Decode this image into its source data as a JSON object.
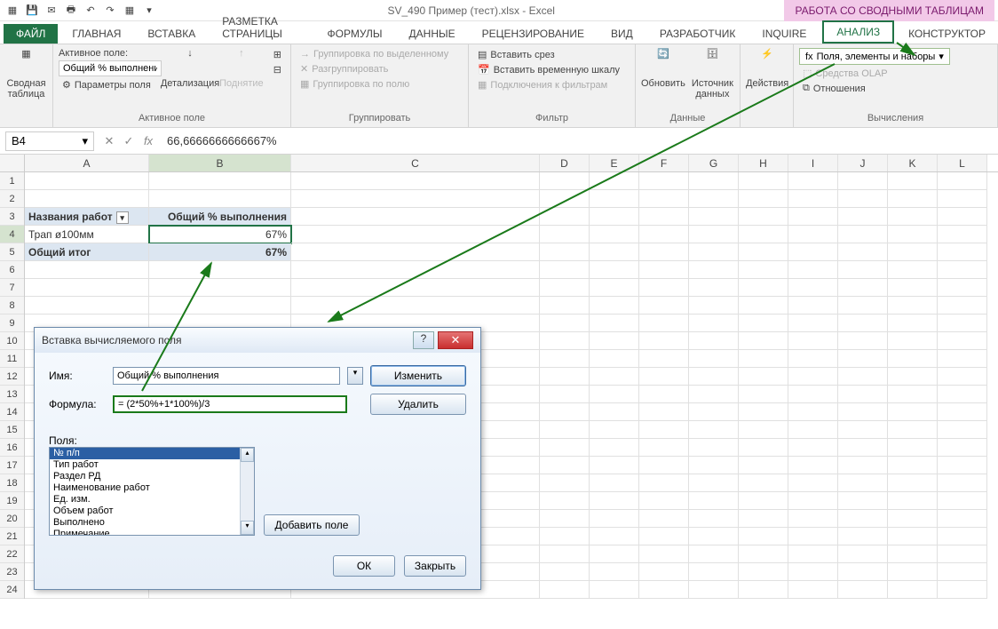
{
  "title": "SV_490 Пример (тест).xlsx - Excel",
  "context_title": "РАБОТА СО СВОДНЫМИ ТАБЛИЦАМ",
  "tabs": {
    "file": "ФАЙЛ",
    "home": "ГЛАВНАЯ",
    "insert": "ВСТАВКА",
    "layout": "РАЗМЕТКА СТРАНИЦЫ",
    "formulas": "ФОРМУЛЫ",
    "data": "ДАННЫЕ",
    "review": "РЕЦЕНЗИРОВАНИЕ",
    "view": "ВИД",
    "developer": "РАЗРАБОТЧИК",
    "inquire": "INQUIRE",
    "analyze": "АНАЛИЗ",
    "design": "КОНСТРУКТОР"
  },
  "ribbon": {
    "pivot": "Сводная\nтаблица",
    "active_field_label": "Активное поле:",
    "active_field_value": "Общий % выполнени",
    "field_settings": "Параметры поля",
    "active_field_group": "Активное поле",
    "detail": "Детализация",
    "collapse": "Поднятие",
    "group_sel": "Группировка по выделенному",
    "ungroup": "Разгруппировать",
    "group_field": "Группировка по полю",
    "group_group": "Группировать",
    "slicer": "Вставить срез",
    "timeline": "Вставить временную шкалу",
    "filter_conn": "Подключения к фильтрам",
    "filter_group": "Фильтр",
    "refresh": "Обновить",
    "datasource": "Источник\nданных",
    "data_group": "Данные",
    "actions": "Действия",
    "fields_calc": "Поля, элементы и наборы",
    "olap": "Средства OLAP",
    "relations": "Отношения",
    "calc_group": "Вычисления"
  },
  "namebox": "B4",
  "formula": "66,6666666666667%",
  "columns": [
    "A",
    "B",
    "C",
    "D",
    "E",
    "F",
    "G",
    "H",
    "I",
    "J",
    "K",
    "L"
  ],
  "pivot": {
    "h1": "Названия работ",
    "h2": "Общий % выполнения",
    "r1c1": "Трап ø100мм",
    "r1c2": "67%",
    "r2c1": "Общий итог",
    "r2c2": "67%"
  },
  "dialog": {
    "title": "Вставка вычисляемого поля",
    "name_label": "Имя:",
    "name_value": "Общий % выполнения",
    "formula_label": "Формула:",
    "formula_value": "= (2*50%+1*100%)/3",
    "change": "Изменить",
    "delete": "Удалить",
    "fields_label": "Поля:",
    "fields": [
      "№ п/п",
      "Тип работ",
      "Раздел РД",
      "Наименование работ",
      "Ед. изм.",
      "Объем работ",
      "Выполнено",
      "Примечание"
    ],
    "add_field": "Добавить поле",
    "ok": "ОК",
    "close": "Закрыть"
  }
}
